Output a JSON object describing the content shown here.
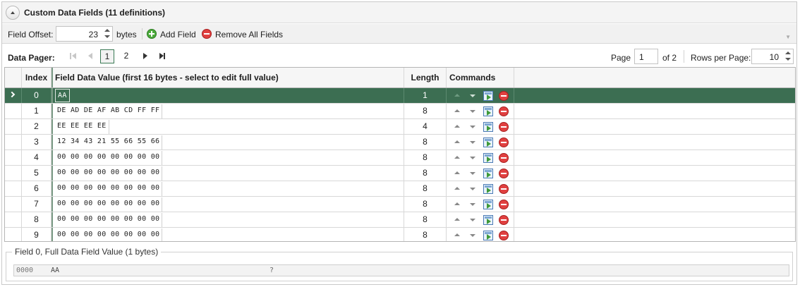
{
  "header": {
    "title": "Custom Data Fields (11 definitions)"
  },
  "toolbar": {
    "field_offset_label": "Field Offset:",
    "field_offset_value": "23",
    "bytes_label": "bytes",
    "add_field_label": "Add Field",
    "remove_all_label": "Remove All Fields"
  },
  "pager": {
    "label": "Data Pager:",
    "pages": [
      "1",
      "2"
    ],
    "current_page_index": 0,
    "page_label": "Page",
    "page_input": "1",
    "of_label": "of 2",
    "rows_per_page_label": "Rows per Page:",
    "rows_per_page_value": "10"
  },
  "grid": {
    "columns": [
      "Index",
      "Field Data Value (first 16 bytes - select to edit full value)",
      "Length",
      "Commands"
    ],
    "selected_row_index": 0,
    "rows": [
      {
        "index": "0",
        "value": "AA",
        "length": "1"
      },
      {
        "index": "1",
        "value": "DE AD DE AF AB CD FF FF",
        "length": "8"
      },
      {
        "index": "2",
        "value": "EE EE EE EE",
        "length": "4"
      },
      {
        "index": "3",
        "value": "12 34 43 21 55 66 55 66",
        "length": "8"
      },
      {
        "index": "4",
        "value": "00 00 00 00 00 00 00 00",
        "length": "8"
      },
      {
        "index": "5",
        "value": "00 00 00 00 00 00 00 00",
        "length": "8"
      },
      {
        "index": "6",
        "value": "00 00 00 00 00 00 00 00",
        "length": "8"
      },
      {
        "index": "7",
        "value": "00 00 00 00 00 00 00 00",
        "length": "8"
      },
      {
        "index": "8",
        "value": "00 00 00 00 00 00 00 00",
        "length": "8"
      },
      {
        "index": "9",
        "value": "00 00 00 00 00 00 00 00",
        "length": "8"
      }
    ]
  },
  "detail": {
    "legend": "Field 0, Full Data Field Value (1 bytes)",
    "offset": "0000",
    "hex": "AA",
    "ascii": "?"
  },
  "colors": {
    "selected_row": "#3c6e52",
    "add_icon": "#4caa3c",
    "remove_icon": "#e04040"
  }
}
